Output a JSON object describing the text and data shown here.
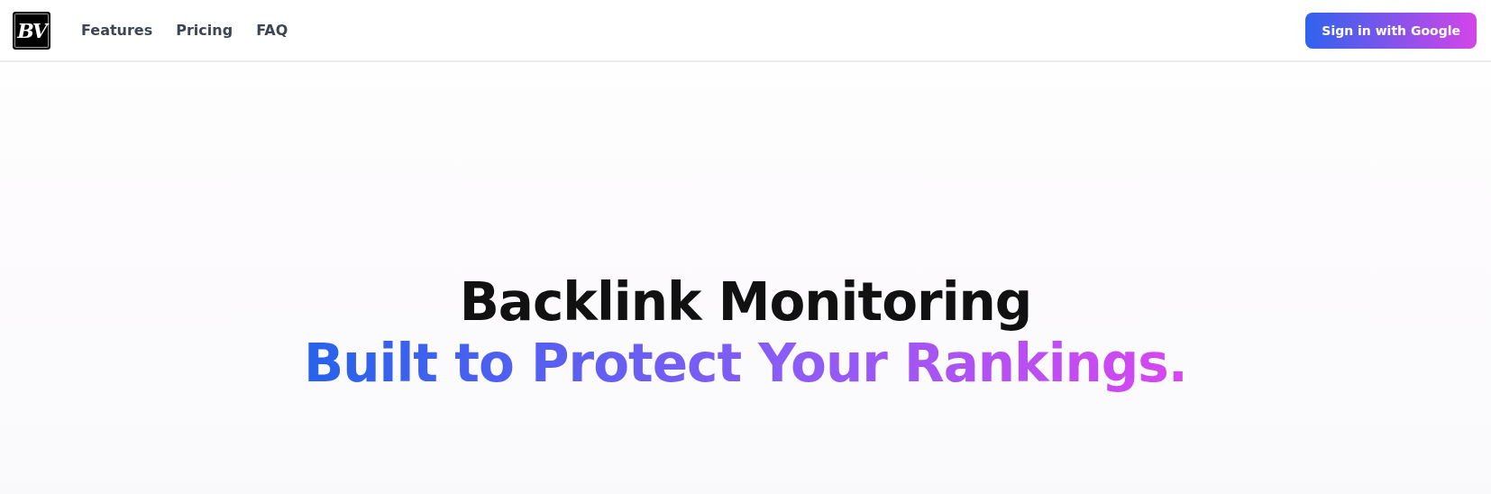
{
  "header": {
    "logo": "BV",
    "nav": [
      {
        "label": "Features"
      },
      {
        "label": "Pricing"
      },
      {
        "label": "FAQ"
      }
    ],
    "sign_in": "Sign in with Google"
  },
  "hero": {
    "title": "Backlink Monitoring",
    "subtitle": "Built to Protect Your Rankings."
  }
}
